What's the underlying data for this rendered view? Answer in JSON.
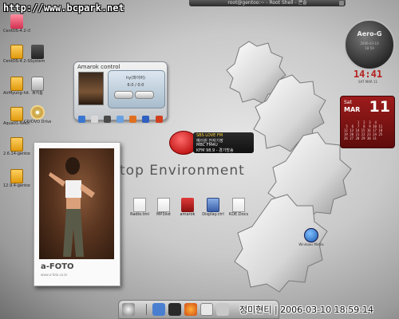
{
  "watermark": "http://www.bcpark.net",
  "window_title": "root@gentoo:~ - Root Shell - 콘솔",
  "desktop_icons": [
    {
      "label": "CentOS-4.2-i386-bin",
      "icon": "pink-package-icon"
    },
    {
      "label": "CentOS-4.2-Server",
      "icon": "folder-icon"
    },
    {
      "label": "AirMyung-hit.1.2",
      "icon": "folder-icon"
    },
    {
      "label": "Aqua01-NAO.1.9.1",
      "icon": "folder-icon"
    },
    {
      "label": "2.6.14-gentoo-r5",
      "icon": "folder-icon"
    },
    {
      "label": "12.9.4-gentoo-r1",
      "icon": "folder-icon"
    },
    {
      "label": "System",
      "icon": "laptop-icon"
    },
    {
      "label": "휴지통",
      "icon": "trash-icon"
    },
    {
      "label": "CD/DVD Drive",
      "icon": "cd-icon"
    }
  ],
  "amarok": {
    "title": "Amarok control",
    "track": "hy(파이버)",
    "sub": "6:0 / 0:0"
  },
  "photo": {
    "brand": "a-FOTO",
    "caption": "www.a-foto.co.kr"
  },
  "radio": {
    "station": "SBS LOVE FM",
    "line2": "예이원 전자기장",
    "line3": "MBC FM4U",
    "line4": "KFM 98.9 - 경기방송"
  },
  "desktop_text": "top Environment",
  "file_icons": [
    {
      "label": "Radio.tml",
      "icon": "document-icon"
    },
    {
      "label": "MP3list",
      "icon": "document-icon"
    },
    {
      "label": "amarok",
      "icon": "music-icon"
    },
    {
      "label": "Display.ctrl",
      "icon": "monitor-icon"
    },
    {
      "label": "KDE.Docs",
      "icon": "document-icon"
    }
  ],
  "aero": {
    "name": "Aero-G",
    "line1": "2006-03-10",
    "line2": "18:59"
  },
  "clock": {
    "time": "14:41",
    "sub": "SAT MAR 11"
  },
  "calendar": {
    "weekday": "Sat",
    "month": "MAR",
    "day": "11",
    "grid": "       1  2  3  4\n 5  6  7  8  9 10 11\n12 13 14 15 16 17 18\n19 20 21 22 23 24 25\n26 27 28 29 30 31"
  },
  "windows_media": {
    "label": "Windows Media"
  },
  "datetime": "정미현티 | 2006-03-10 18:59:14",
  "colors": {
    "accent": "#b3221f",
    "calendar": "#8a1414"
  }
}
